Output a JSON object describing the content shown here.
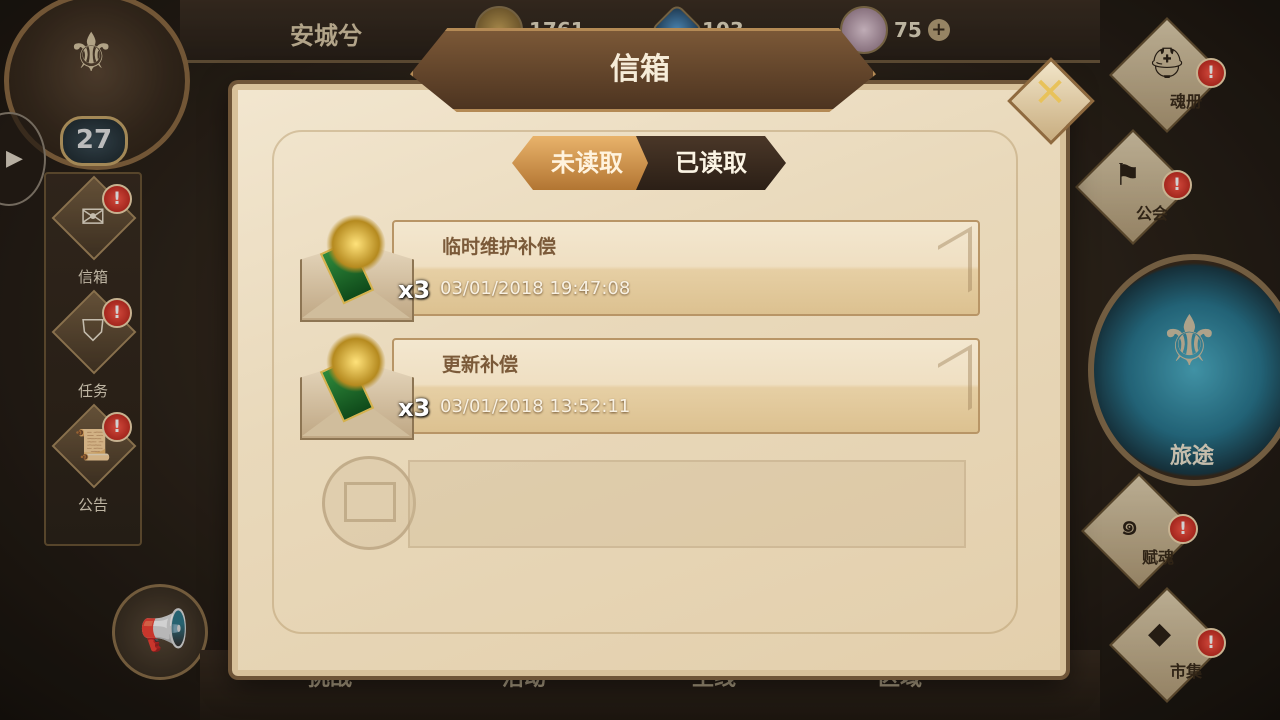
{
  "topbar": {
    "player_name": "安城兮",
    "gold_amount": "1761",
    "gem_amount": "103",
    "crystal_amount": "75",
    "plus_label": "+"
  },
  "player": {
    "level": "27"
  },
  "left_menu": {
    "items": [
      {
        "label": "信箱",
        "icon": "envelope-icon",
        "alert": "!"
      },
      {
        "label": "任务",
        "icon": "quest-shield-icon",
        "alert": "!"
      },
      {
        "label": "公告",
        "icon": "announcement-scroll-icon",
        "alert": "!"
      }
    ]
  },
  "right_menu": {
    "items": [
      {
        "label": "魂册",
        "icon": "helmet-icon",
        "alert": "!"
      },
      {
        "label": "公会",
        "icon": "guild-banner-icon",
        "alert": "!"
      },
      {
        "label": "赋魂",
        "icon": "soul-swirl-icon",
        "alert": "!"
      },
      {
        "label": "市集",
        "icon": "market-crystal-icon",
        "alert": "!"
      }
    ],
    "journey_label": "旅途"
  },
  "bottom_nav": {
    "items": [
      "挑战",
      "活动",
      "主线",
      "区域"
    ]
  },
  "mailbox": {
    "title": "信箱",
    "close_icon": "close-x-icon",
    "tabs": {
      "unread": "未读取",
      "read": "已读取"
    },
    "mails": [
      {
        "subject": "临时维护补偿",
        "time": "03/01/2018 19:47:08",
        "quantity": "x3"
      },
      {
        "subject": "更新补偿",
        "time": "03/01/2018 13:52:11",
        "quantity": "x3"
      }
    ]
  },
  "colors": {
    "panel_bg": "#efe2c7",
    "title_plate": "#6b4a2e",
    "tab_unread": "#d2954d",
    "tab_read": "#3a2b1f",
    "alert_red": "#d92a1f"
  }
}
